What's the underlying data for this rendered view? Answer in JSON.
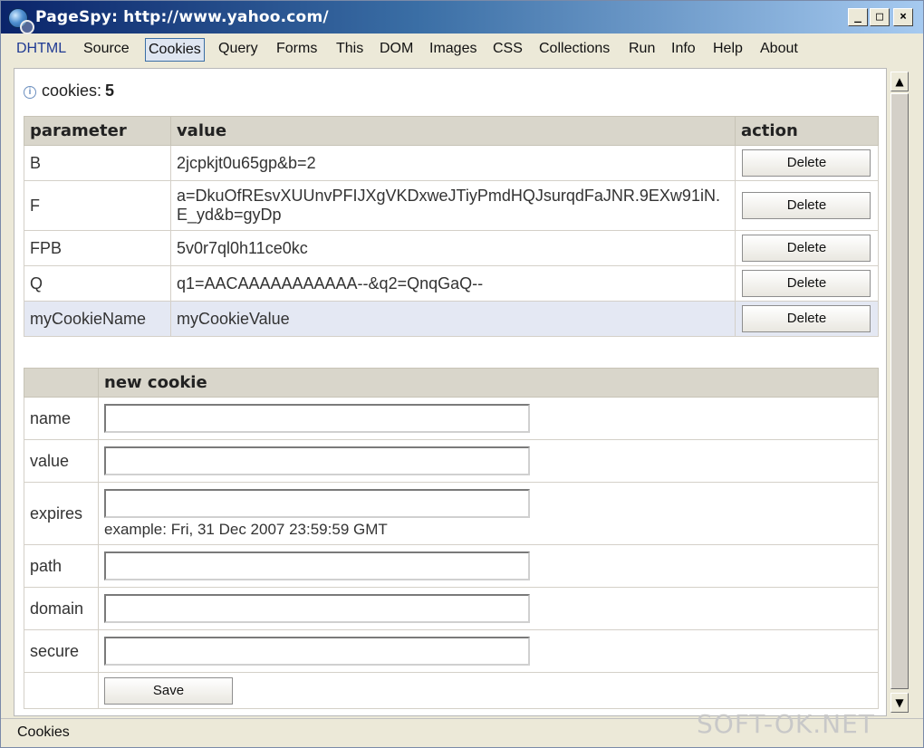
{
  "window": {
    "title": "PageSpy: http://www.yahoo.com/",
    "controls": {
      "minimize": "_",
      "maximize": "□",
      "close": "×"
    }
  },
  "menu": {
    "items": [
      "DHTML",
      "Source",
      "Cookies",
      "Query",
      "Forms",
      "This",
      "DOM",
      "Images",
      "CSS",
      "Collections",
      "Run",
      "Info",
      "Help",
      "About"
    ],
    "active": "Cookies"
  },
  "summary": {
    "label": "cookies:",
    "count": "5"
  },
  "cookies_table": {
    "headers": {
      "parameter": "parameter",
      "value": "value",
      "action": "action"
    },
    "rows": [
      {
        "parameter": "B",
        "value": "2jcpkjt0u65gp&b=2",
        "action": "Delete"
      },
      {
        "parameter": "F",
        "value": "a=DkuOfREsvXUUnvPFIJXgVKDxweJTiyPmdHQJsurqdFaJNR.9EXw91iN.E_yd&b=gyDp",
        "action": "Delete"
      },
      {
        "parameter": "FPB",
        "value": "5v0r7ql0h11ce0kc",
        "action": "Delete"
      },
      {
        "parameter": "Q",
        "value": "q1=AACAAAAAAAAAAA--&q2=QnqGaQ--",
        "action": "Delete"
      },
      {
        "parameter": "myCookieName",
        "value": "myCookieValue",
        "action": "Delete"
      }
    ]
  },
  "new_cookie": {
    "header": "new cookie",
    "fields": {
      "name": {
        "label": "name",
        "value": ""
      },
      "value": {
        "label": "value",
        "value": ""
      },
      "expires": {
        "label": "expires",
        "value": "",
        "hint": "example: Fri, 31 Dec 2007 23:59:59 GMT"
      },
      "path": {
        "label": "path",
        "value": ""
      },
      "domain": {
        "label": "domain",
        "value": ""
      },
      "secure": {
        "label": "secure",
        "value": ""
      }
    },
    "save_label": "Save"
  },
  "statusbar": {
    "text": "Cookies"
  },
  "watermark": {
    "text": "SOFT-OK.NET"
  }
}
